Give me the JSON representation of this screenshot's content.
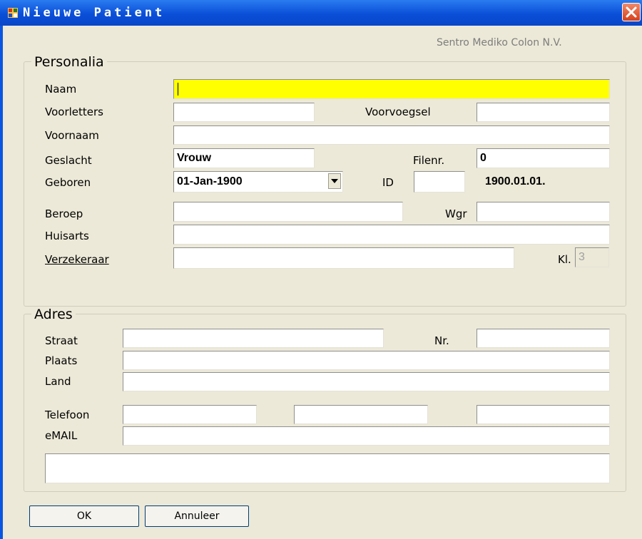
{
  "window": {
    "title": "Nieuwe Patient"
  },
  "company": "Sentro Mediko Colon N.V.",
  "personalia": {
    "legend": "Personalia",
    "naam_label": "Naam",
    "naam_value": "",
    "voorletters_label": "Voorletters",
    "voorletters_value": "",
    "voorvoegsel_label": "Voorvoegsel",
    "voorvoegsel_value": "",
    "voornaam_label": "Voornaam",
    "voornaam_value": "",
    "geslacht_label": "Geslacht",
    "geslacht_value": "Vrouw",
    "filenr_label": "Filenr.",
    "filenr_value": "0",
    "geboren_label": "Geboren",
    "geboren_value": "01-Jan-1900",
    "id_label": "ID",
    "id_value": "",
    "id_text": "1900.01.01.",
    "beroep_label": "Beroep",
    "beroep_value": "",
    "wgr_label": "Wgr",
    "wgr_value": "",
    "huisarts_label": "Huisarts",
    "huisarts_value": "",
    "verzekeraar_label": "Verzekeraar",
    "verzekeraar_value": "",
    "kl_label": "Kl.",
    "kl_value": "3"
  },
  "adres": {
    "legend": "Adres",
    "straat_label": "Straat",
    "straat_value": "",
    "nr_label": "Nr.",
    "nr_value": "",
    "plaats_label": "Plaats",
    "plaats_value": "",
    "land_label": "Land",
    "land_value": "",
    "telefoon_label": "Telefoon",
    "telefoon_1": "",
    "telefoon_2": "",
    "telefoon_3": "",
    "email_label": "eMAIL",
    "email_value": "",
    "notes_value": ""
  },
  "buttons": {
    "ok": "OK",
    "annuleer": "Annuleer"
  },
  "colors": {
    "title_bar": "#0a56e2",
    "required_field": "#ffff00",
    "dialog_bg": "#ece9d8"
  }
}
